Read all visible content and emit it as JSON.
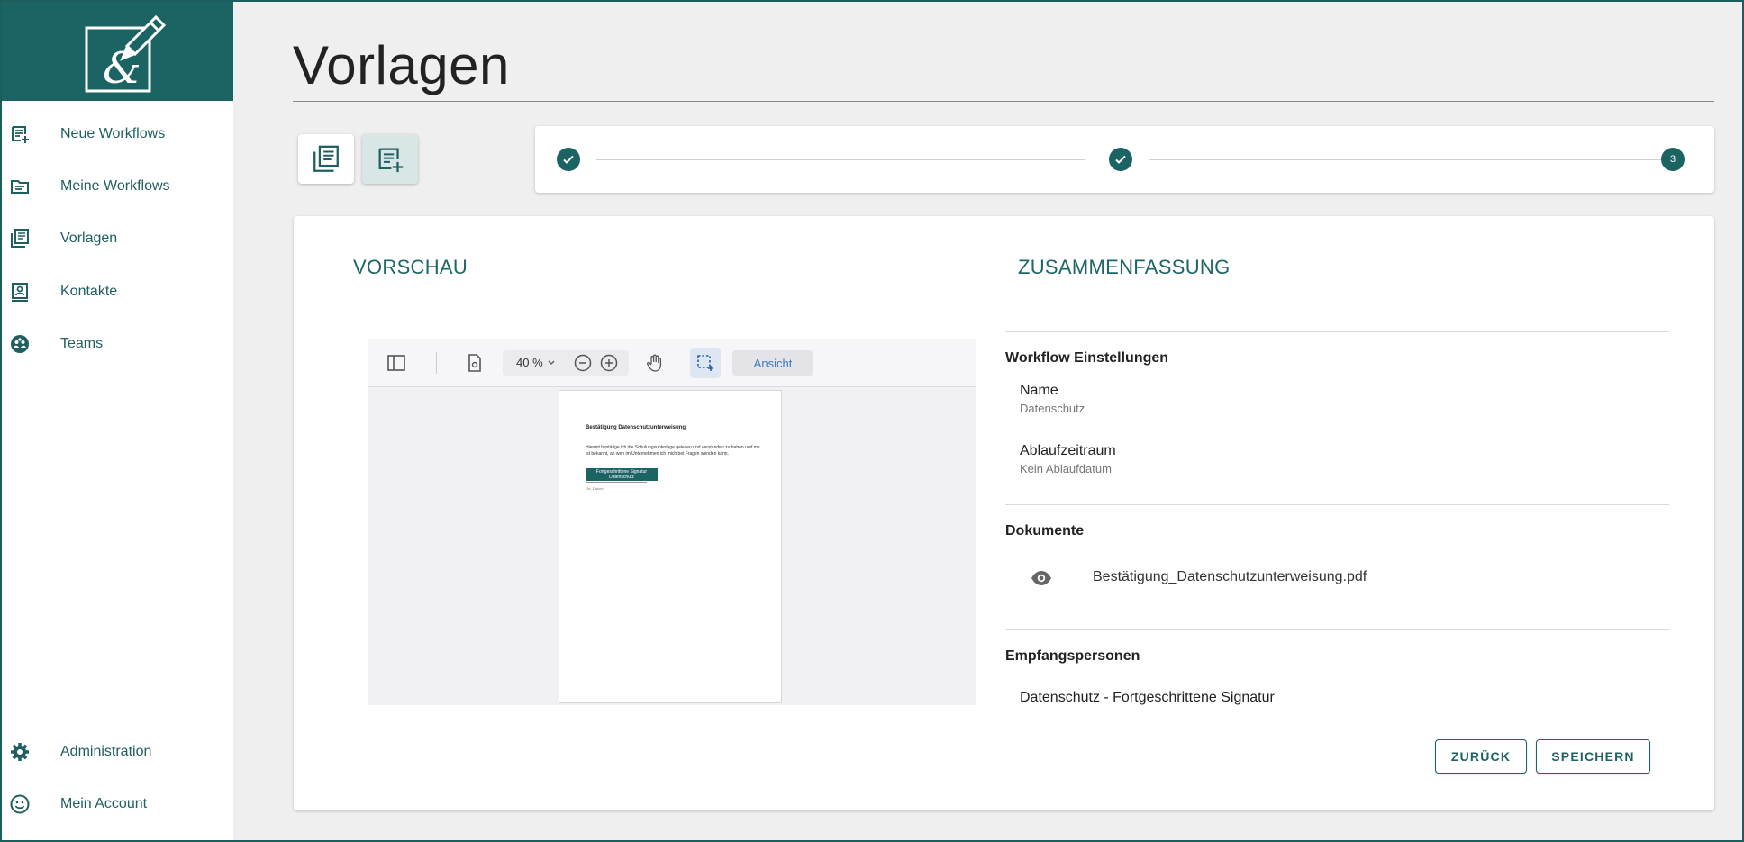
{
  "sidebar": {
    "items": [
      {
        "label": "Neue Workflows",
        "icon": "new-workflow-icon"
      },
      {
        "label": "Meine Workflows",
        "icon": "folder-icon"
      },
      {
        "label": "Vorlagen",
        "icon": "templates-icon"
      },
      {
        "label": "Kontakte",
        "icon": "contacts-icon"
      },
      {
        "label": "Teams",
        "icon": "teams-icon"
      }
    ],
    "bottom_items": [
      {
        "label": "Administration",
        "icon": "gear-icon"
      },
      {
        "label": "Mein Account",
        "icon": "smiley-icon"
      }
    ]
  },
  "page": {
    "title": "Vorlagen"
  },
  "stepper": {
    "steps": [
      "",
      "",
      "3"
    ]
  },
  "preview": {
    "title": "VORSCHAU",
    "zoom": "40 %",
    "view_button": "Ansicht",
    "document": {
      "heading": "Bestätigung Datenschutzunterweisung",
      "body": "Hiermit bestätige ich die Schulungsunterlage gelesen und verstanden zu haben und mir ist bekannt, an wen im Unternehmen ich mich bei Fragen wenden kann.",
      "signature_line1": "Fortgeschrittene Signatur",
      "signature_line2": "Datenschutz",
      "footer": "Ort, Datum"
    }
  },
  "summary": {
    "title": "ZUSAMMENFASSUNG",
    "workflow_settings_heading": "Workflow Einstellungen",
    "name_label": "Name",
    "name_value": "Datenschutz",
    "expiry_label": "Ablaufzeitraum",
    "expiry_value": "Kein Ablaufdatum",
    "documents_heading": "Dokumente",
    "document_name": "Bestätigung_Datenschutzunterweisung.pdf",
    "recipients_heading": "Empfangspersonen",
    "recipient": "Datenschutz - Fortgeschrittene Signatur"
  },
  "actions": {
    "back_label": "ZURÜCK",
    "save_label": "SPEICHERN"
  },
  "colors": {
    "brand": "#1c6464",
    "accent_text": "#1f6767"
  }
}
